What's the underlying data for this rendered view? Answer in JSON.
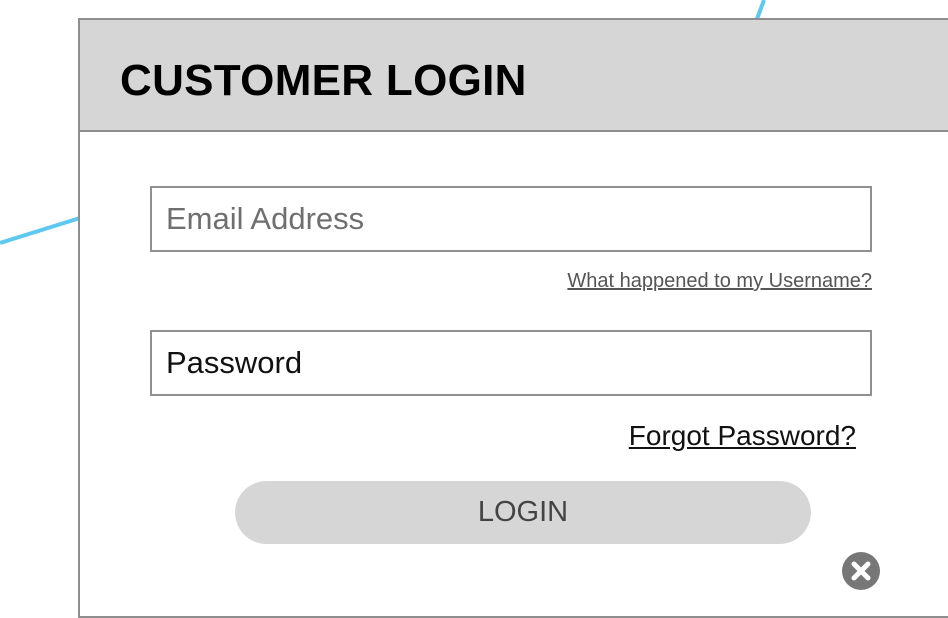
{
  "header": {
    "title": "CUSTOMER LOGIN"
  },
  "form": {
    "email_placeholder": "Email Address",
    "username_link": "What happened to my Username?",
    "password_placeholder": "Password",
    "forgot_link": "Forgot Password?",
    "login_label": "LOGIN"
  },
  "icons": {
    "close": "close-icon",
    "connector": "connector-line"
  },
  "colors": {
    "header_bg": "#d6d6d6",
    "border": "#8e8e8e",
    "button_bg": "#d6d6d6",
    "connector": "#5ec8f0",
    "close_icon": "#777777"
  }
}
